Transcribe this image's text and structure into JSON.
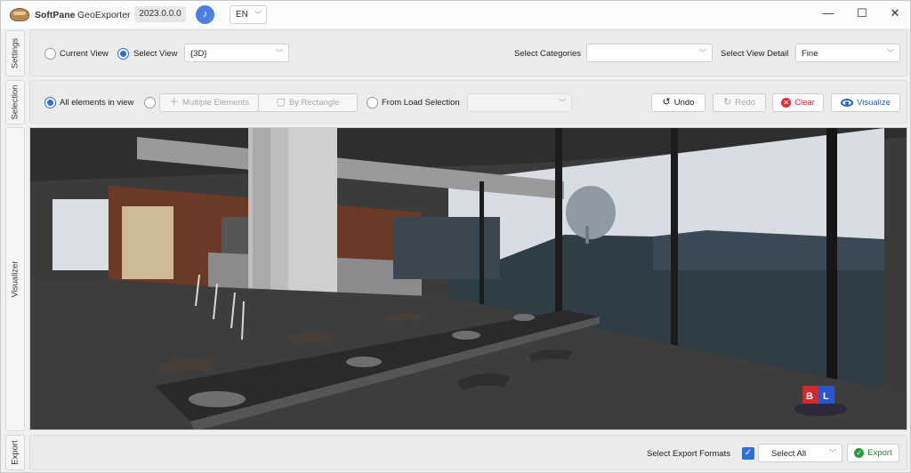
{
  "titlebar": {
    "app_name": "SoftPane",
    "product": "GeoExporter",
    "version": "2023.0.0.0",
    "language": "EN",
    "theme_icon": "music-note-icon",
    "minimize": "—",
    "maximize": "☐",
    "close": "✕"
  },
  "sidetabs": {
    "settings": "Settings",
    "selection": "Selection",
    "visualizer": "Visualizer",
    "export": "Export"
  },
  "settings": {
    "current_view": "Current View",
    "select_view": "Select View",
    "view_value": "{3D}",
    "select_categories_label": "Select Categories",
    "categories_value": "",
    "select_view_detail_label": "Select View Detail",
    "view_detail_value": "Fine"
  },
  "selection": {
    "all_elements": "All elements in view",
    "multiple_elements": "Multiple Elements",
    "by_rectangle": "By Rectangle",
    "from_load_selection": "From Load Selection",
    "load_selection_value": "",
    "undo": "Undo",
    "redo": "Redo",
    "clear": "Clear",
    "visualize": "Visualize"
  },
  "visualizer": {
    "nav_cube_left": "B",
    "nav_cube_right": "L",
    "scene": "3D interior model view"
  },
  "export": {
    "select_formats_label": "Select Export Formats",
    "formats_value": "Select All",
    "export_button": "Export"
  },
  "colors": {
    "accent": "#2b6fd8",
    "clear_red": "#d93333",
    "export_green": "#2e9a3f"
  }
}
